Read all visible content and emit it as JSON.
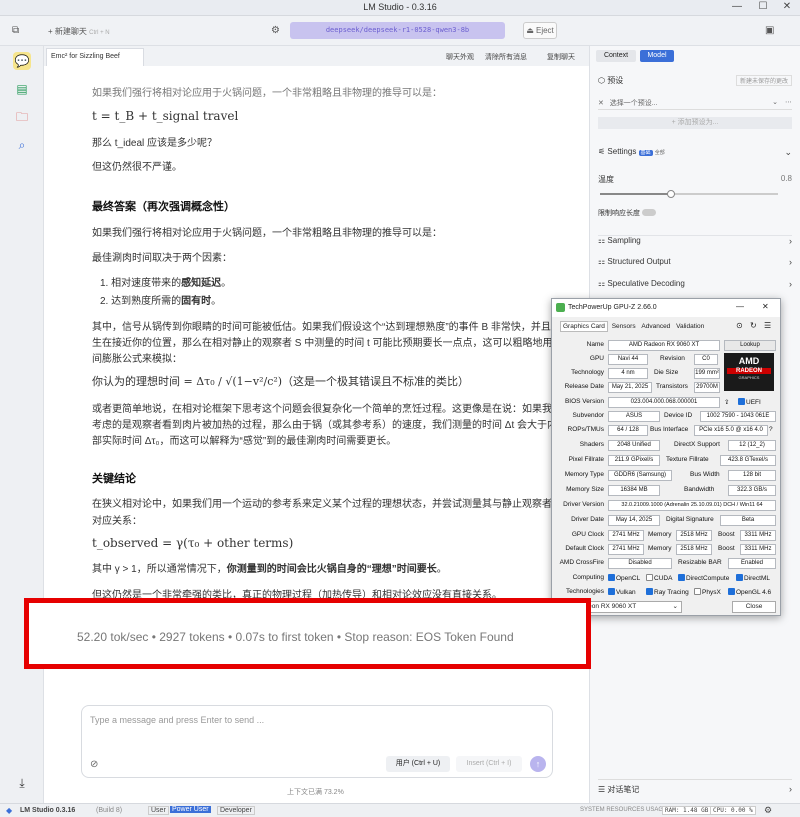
{
  "window": {
    "title": "LM Studio - 0.3.16",
    "minimize": "—",
    "maximize": "☐",
    "close": "✕"
  },
  "toolbar": {
    "new_chat": "+ 新建聊天",
    "new_chat_shortcut": "Ctrl + N",
    "model": "deepseek/deepseek-r1-0528-qwen3-8b",
    "eject": "Eject"
  },
  "chat_tab": {
    "title": "Emc² for Sizzling Beef",
    "actions": [
      "聊天外观",
      "清除所有消息",
      "复制聊天"
    ]
  },
  "chat": {
    "line0": "如果我们强行将相对论应用于火锅问题，一个非常粗略且非物理的推导可以是：",
    "eq1": "t = t_B + t_signal travel",
    "q1": "那么 t_ideal 应该是多少呢？",
    "q2": "但这仍然很不严谨。",
    "h_final": "最终答案（再次强调概念性）",
    "p1": "如果我们强行将相对论应用于火锅问题，一个非常粗略且非物理的推导可以是：",
    "p2": "最佳涮肉时间取决于两个因素：",
    "li1_pre": "相对速度带来的",
    "li1_bold": "感知延迟",
    "li1_post": "。",
    "li2_pre": "达到熟度所需的",
    "li2_bold": "固有时",
    "li2_post": "。",
    "p3a": "其中，信号从锅传到你眼睛的时间可能被低估。如果我们假设这个“达到理想熟度”的事件 B 非常快，并且发",
    "p3b": "生在接近你的位置，那么在相对静止的观察者 S 中测量的时间 t 可能比预期要长一点点，这可以粗略地用时",
    "p3c": "间膨胀公式来模拟：",
    "eq2": "你认为的理想时间 = Δτ₀ / √(1−v²/c²)（这是一个极其错误且不标准的类比）",
    "p4a": "或者更简单地说，在相对论框架下思考这个问题会很复杂化一个简单的烹饪过程。这更像是在说：如果我们",
    "p4b": "考虑的是观察者看到肉片被加热的过程，那么由于锅（或其参考系）的速度，我们测量的时间 Δt 会大于内",
    "p4c": "部实际时间 Δτ₀，而这可以解释为“感觉”到的最佳涮肉时间需要更长。",
    "h_key": "关键结论",
    "p5a": "在狭义相对论中，如果我们用一个运动的参考系来定义某个过程的理想状态，并尝试测量其与静止观察者的",
    "p5b": "对应关系：",
    "eq3": "t_observed = γ(τ₀ + other terms)",
    "p6_pre": "其中 γ > 1，所以通常情况下，",
    "p6_bold": "你测量到的时间会比火锅自身的“理想”时间要长",
    "p6_post": "。",
    "p7": "但这仍然是一个非常牵强的类比，真正的物理过程（加热传导）和相对论效应没有直接关系。"
  },
  "stats": {
    "text": "52.20 tok/sec • 2927 tokens • 0.07s to first token • Stop reason: EOS Token Found"
  },
  "input": {
    "placeholder": "Type a message and press Enter to send ...",
    "user_btn": "用户 (Ctrl + U)",
    "insert_btn": "Insert (Ctrl + I)",
    "context": "上下文已满 73.2%"
  },
  "right_panel": {
    "tabs": [
      "Context",
      "Model"
    ],
    "preset_label": "预设",
    "preset_action": "新建未保存的更改",
    "preset_select": "选择一个预设...",
    "preset_add": "+ 添加预设为...",
    "settings": "Settings",
    "settings_badge": "基础",
    "settings_badge2": "全部",
    "temp_label": "温度",
    "temp_value": "0.8",
    "temperature": 0.8,
    "limit_label": "限制响应长度",
    "sections": [
      "Sampling",
      "Structured Output",
      "Speculative Decoding"
    ],
    "notes": "对话笔记"
  },
  "gpuz": {
    "title": "TechPowerUp GPU-Z 2.66.0",
    "tabs": [
      "Graphics Card",
      "Sensors",
      "Advanced",
      "Validation"
    ],
    "name": "AMD Radeon RX 9060 XT",
    "lookup": "Lookup",
    "gpu": "Navi 44",
    "revision": "C0",
    "technology": "4 nm",
    "die_size": "199 mm²",
    "release": "May 21, 2025",
    "transistors": "29700M",
    "bios": "023.004.000.068.000001",
    "uefi": "UEFI",
    "subvendor": "ASUS",
    "device_id": "1002 7590 - 1043 061E",
    "rops": "64 / 128",
    "bus": "PCIe x16 5.0 @ x16 4.0",
    "shaders": "2048 Unified",
    "directx": "12 (12_2)",
    "pixel": "211.9 GPixel/s",
    "texture": "423.8 GTexel/s",
    "memtype": "GDDR6 (Samsung)",
    "buswidth": "128 bit",
    "memsize": "16384 MB",
    "bandwidth": "322.3 GB/s",
    "driver_ver": "32.0.21009.1000 (Adrenalin 25.10.09.01) DCH / Win11 64",
    "driver_date": "May 14, 2025",
    "digital_sig": "Beta",
    "gpu_clock": "2741 MHz",
    "mem_clock": "2518 MHz",
    "boost": "3311 MHz",
    "def_clock": "2741 MHz",
    "def_mem": "2518 MHz",
    "def_boost": "3311 MHz",
    "crossfire": "Disabled",
    "resizable_bar": "Enabled",
    "computing": [
      "OpenCL",
      "CUDA",
      "DirectCompute",
      "DirectML"
    ],
    "technologies": [
      "Vulkan",
      "Ray Tracing",
      "PhysX",
      "OpenGL 4.6"
    ],
    "select": "AMD Radeon RX 9060 XT",
    "close": "Close",
    "labels": {
      "name": "Name",
      "gpu": "GPU",
      "revision": "Revision",
      "technology": "Technology",
      "die": "Die Size",
      "release": "Release Date",
      "transistors": "Transistors",
      "bios": "BIOS Version",
      "subvendor": "Subvendor",
      "device": "Device ID",
      "rops": "ROPs/TMUs",
      "bus": "Bus Interface",
      "shaders": "Shaders",
      "directx": "DirectX Support",
      "pixel": "Pixel Fillrate",
      "texture": "Texture Fillrate",
      "memtype": "Memory Type",
      "buswidth": "Bus Width",
      "memsize": "Memory Size",
      "bandwidth": "Bandwidth",
      "driver_ver": "Driver Version",
      "driver_date": "Driver Date",
      "digital_sig": "Digital Signature",
      "gpu_clock": "GPU Clock",
      "memory": "Memory",
      "boost": "Boost",
      "default_clock": "Default Clock",
      "crossfire": "AMD CrossFire",
      "rebar": "Resizable BAR",
      "computing": "Computing",
      "technologies": "Technologies"
    },
    "logo_text": "AMD",
    "logo_sub": "RADEON",
    "logo_sub2": "GRAPHICS"
  },
  "statusbar": {
    "app": "LM Studio 0.3.16",
    "build": "(Build 8)",
    "modes": [
      "User",
      "Power User",
      "Developer"
    ],
    "resources": "SYSTEM RESOURCES USAGE:",
    "ram": "RAM: 1.48 GB",
    "cpu": "CPU: 0.00 %"
  }
}
